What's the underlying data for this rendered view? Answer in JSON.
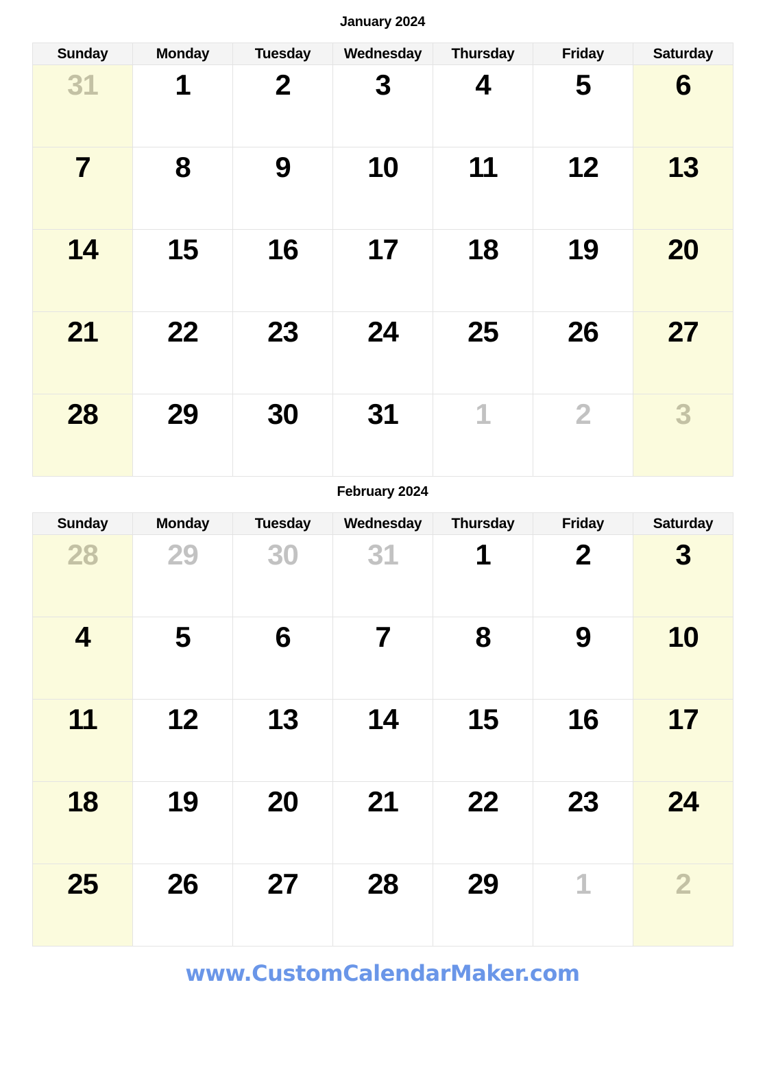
{
  "weekday_headers": [
    "Sunday",
    "Monday",
    "Tuesday",
    "Wednesday",
    "Thursday",
    "Friday",
    "Saturday"
  ],
  "colors": {
    "weekend_background": "#FBFBDD",
    "header_background": "#F4F4F4",
    "grid_line": "#E3E3E3",
    "day_text": "#000000",
    "muted_day_text": "#C2C2C2",
    "muted_weekend_text": "#C3C1A4",
    "footer_link": "#6A96E8"
  },
  "months": [
    {
      "title": "January 2024",
      "weeks": [
        [
          {
            "day": "31",
            "muted": true,
            "weekend": true
          },
          {
            "day": "1",
            "muted": false,
            "weekend": false
          },
          {
            "day": "2",
            "muted": false,
            "weekend": false
          },
          {
            "day": "3",
            "muted": false,
            "weekend": false
          },
          {
            "day": "4",
            "muted": false,
            "weekend": false
          },
          {
            "day": "5",
            "muted": false,
            "weekend": false
          },
          {
            "day": "6",
            "muted": false,
            "weekend": true
          }
        ],
        [
          {
            "day": "7",
            "muted": false,
            "weekend": true
          },
          {
            "day": "8",
            "muted": false,
            "weekend": false
          },
          {
            "day": "9",
            "muted": false,
            "weekend": false
          },
          {
            "day": "10",
            "muted": false,
            "weekend": false
          },
          {
            "day": "11",
            "muted": false,
            "weekend": false
          },
          {
            "day": "12",
            "muted": false,
            "weekend": false
          },
          {
            "day": "13",
            "muted": false,
            "weekend": true
          }
        ],
        [
          {
            "day": "14",
            "muted": false,
            "weekend": true
          },
          {
            "day": "15",
            "muted": false,
            "weekend": false
          },
          {
            "day": "16",
            "muted": false,
            "weekend": false
          },
          {
            "day": "17",
            "muted": false,
            "weekend": false
          },
          {
            "day": "18",
            "muted": false,
            "weekend": false
          },
          {
            "day": "19",
            "muted": false,
            "weekend": false
          },
          {
            "day": "20",
            "muted": false,
            "weekend": true
          }
        ],
        [
          {
            "day": "21",
            "muted": false,
            "weekend": true
          },
          {
            "day": "22",
            "muted": false,
            "weekend": false
          },
          {
            "day": "23",
            "muted": false,
            "weekend": false
          },
          {
            "day": "24",
            "muted": false,
            "weekend": false
          },
          {
            "day": "25",
            "muted": false,
            "weekend": false
          },
          {
            "day": "26",
            "muted": false,
            "weekend": false
          },
          {
            "day": "27",
            "muted": false,
            "weekend": true
          }
        ],
        [
          {
            "day": "28",
            "muted": false,
            "weekend": true
          },
          {
            "day": "29",
            "muted": false,
            "weekend": false
          },
          {
            "day": "30",
            "muted": false,
            "weekend": false
          },
          {
            "day": "31",
            "muted": false,
            "weekend": false
          },
          {
            "day": "1",
            "muted": true,
            "weekend": false
          },
          {
            "day": "2",
            "muted": true,
            "weekend": false
          },
          {
            "day": "3",
            "muted": true,
            "weekend": true
          }
        ]
      ]
    },
    {
      "title": "February 2024",
      "weeks": [
        [
          {
            "day": "28",
            "muted": true,
            "weekend": true
          },
          {
            "day": "29",
            "muted": true,
            "weekend": false
          },
          {
            "day": "30",
            "muted": true,
            "weekend": false
          },
          {
            "day": "31",
            "muted": true,
            "weekend": false
          },
          {
            "day": "1",
            "muted": false,
            "weekend": false
          },
          {
            "day": "2",
            "muted": false,
            "weekend": false
          },
          {
            "day": "3",
            "muted": false,
            "weekend": true
          }
        ],
        [
          {
            "day": "4",
            "muted": false,
            "weekend": true
          },
          {
            "day": "5",
            "muted": false,
            "weekend": false
          },
          {
            "day": "6",
            "muted": false,
            "weekend": false
          },
          {
            "day": "7",
            "muted": false,
            "weekend": false
          },
          {
            "day": "8",
            "muted": false,
            "weekend": false
          },
          {
            "day": "9",
            "muted": false,
            "weekend": false
          },
          {
            "day": "10",
            "muted": false,
            "weekend": true
          }
        ],
        [
          {
            "day": "11",
            "muted": false,
            "weekend": true
          },
          {
            "day": "12",
            "muted": false,
            "weekend": false
          },
          {
            "day": "13",
            "muted": false,
            "weekend": false
          },
          {
            "day": "14",
            "muted": false,
            "weekend": false
          },
          {
            "day": "15",
            "muted": false,
            "weekend": false
          },
          {
            "day": "16",
            "muted": false,
            "weekend": false
          },
          {
            "day": "17",
            "muted": false,
            "weekend": true
          }
        ],
        [
          {
            "day": "18",
            "muted": false,
            "weekend": true
          },
          {
            "day": "19",
            "muted": false,
            "weekend": false
          },
          {
            "day": "20",
            "muted": false,
            "weekend": false
          },
          {
            "day": "21",
            "muted": false,
            "weekend": false
          },
          {
            "day": "22",
            "muted": false,
            "weekend": false
          },
          {
            "day": "23",
            "muted": false,
            "weekend": false
          },
          {
            "day": "24",
            "muted": false,
            "weekend": true
          }
        ],
        [
          {
            "day": "25",
            "muted": false,
            "weekend": true
          },
          {
            "day": "26",
            "muted": false,
            "weekend": false
          },
          {
            "day": "27",
            "muted": false,
            "weekend": false
          },
          {
            "day": "28",
            "muted": false,
            "weekend": false
          },
          {
            "day": "29",
            "muted": false,
            "weekend": false
          },
          {
            "day": "1",
            "muted": true,
            "weekend": false
          },
          {
            "day": "2",
            "muted": true,
            "weekend": true
          }
        ]
      ]
    }
  ],
  "footer": {
    "link_text": "www.CustomCalendarMaker.com"
  }
}
